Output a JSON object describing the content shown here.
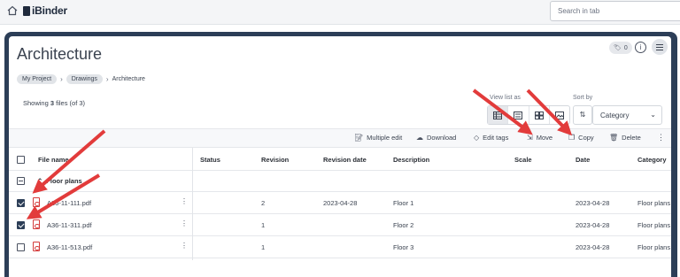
{
  "topbar": {
    "app_name": "iBinder",
    "search_placeholder": "Search in tab"
  },
  "header": {
    "title": "Architecture",
    "tag_count": "0",
    "info_glyph": "i"
  },
  "breadcrumb": {
    "items": [
      "My Project",
      "Drawings"
    ],
    "current": "Architecture"
  },
  "summary": {
    "prefix": "Showing ",
    "count": "3",
    "files_word": " files ",
    "total": "(of 3)"
  },
  "view_list": {
    "label": "View list as",
    "options": [
      "table-view-icon",
      "list-view-icon",
      "grid-view-icon",
      "image-view-icon"
    ],
    "active_index": 0
  },
  "sort": {
    "label": "Sort by",
    "value": "Category"
  },
  "actions": {
    "multiple_edit": "Multiple edit",
    "download": "Download",
    "edit_tags": "Edit tags",
    "move": "Move",
    "copy": "Copy",
    "delete": "Delete"
  },
  "table": {
    "headers": {
      "file_name": "File name",
      "status": "Status",
      "revision": "Revision",
      "revision_date": "Revision date",
      "description": "Description",
      "scale": "Scale",
      "date": "Date",
      "category": "Category"
    },
    "group": "Floor plans",
    "rows": [
      {
        "name": "A36-11-111.pdf",
        "status": "",
        "revision": "2",
        "revision_date": "2023-04-28",
        "description": "Floor 1",
        "scale": "",
        "date": "2023-04-28",
        "category": "Floor plans",
        "checked": true
      },
      {
        "name": "A36-11-311.pdf",
        "status": "",
        "revision": "1",
        "revision_date": "",
        "description": "Floor 2",
        "scale": "",
        "date": "2023-04-28",
        "category": "Floor plans",
        "checked": true
      },
      {
        "name": "A36-11-513.pdf",
        "status": "",
        "revision": "1",
        "revision_date": "",
        "description": "Floor 3",
        "scale": "",
        "date": "2023-04-28",
        "category": "Floor plans",
        "checked": false
      }
    ]
  },
  "colors": {
    "frame": "#2c3e57",
    "annotation_arrow": "#e23b3b",
    "pdf_red": "#d43b3b"
  }
}
